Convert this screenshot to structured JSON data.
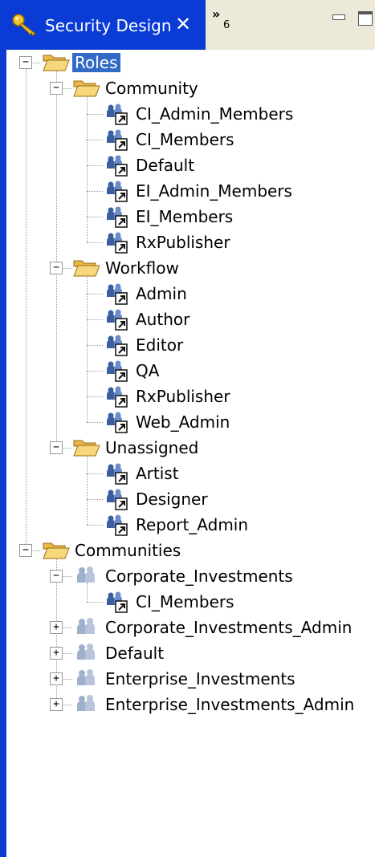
{
  "tab": {
    "title": "Security Design",
    "close_label": "✕",
    "overflow_label": "»",
    "overflow_count": "6"
  },
  "colors": {
    "tab_active": "#0a3bd4",
    "selection": "#316ac5",
    "tab_strip": "#ece9d8"
  },
  "tree": [
    {
      "label": "Roles",
      "icon": "folder-open-icon",
      "depth": 0,
      "toggle": "collapse",
      "selected": true
    },
    {
      "label": "Community",
      "icon": "folder-open-icon",
      "depth": 1,
      "toggle": "collapse"
    },
    {
      "label": "CI_Admin_Members",
      "icon": "role-link-icon",
      "depth": 2
    },
    {
      "label": "CI_Members",
      "icon": "role-link-icon",
      "depth": 2
    },
    {
      "label": "Default",
      "icon": "role-link-icon",
      "depth": 2
    },
    {
      "label": "EI_Admin_Members",
      "icon": "role-link-icon",
      "depth": 2
    },
    {
      "label": "EI_Members",
      "icon": "role-link-icon",
      "depth": 2
    },
    {
      "label": "RxPublisher",
      "icon": "role-link-icon",
      "depth": 2
    },
    {
      "label": "Workflow",
      "icon": "folder-open-icon",
      "depth": 1,
      "toggle": "collapse"
    },
    {
      "label": "Admin",
      "icon": "role-link-icon",
      "depth": 2
    },
    {
      "label": "Author",
      "icon": "role-link-icon",
      "depth": 2
    },
    {
      "label": "Editor",
      "icon": "role-link-icon",
      "depth": 2
    },
    {
      "label": "QA",
      "icon": "role-link-icon",
      "depth": 2
    },
    {
      "label": "RxPublisher",
      "icon": "role-link-icon",
      "depth": 2
    },
    {
      "label": "Web_Admin",
      "icon": "role-link-icon",
      "depth": 2
    },
    {
      "label": "Unassigned",
      "icon": "folder-open-icon",
      "depth": 1,
      "toggle": "collapse"
    },
    {
      "label": "Artist",
      "icon": "role-link-icon",
      "depth": 2
    },
    {
      "label": "Designer",
      "icon": "role-link-icon",
      "depth": 2
    },
    {
      "label": "Report_Admin",
      "icon": "role-link-icon",
      "depth": 2
    },
    {
      "label": "Communities",
      "icon": "folder-open-icon",
      "depth": 0,
      "toggle": "collapse"
    },
    {
      "label": "Corporate_Investments",
      "icon": "community-icon",
      "depth": 1,
      "toggle": "collapse"
    },
    {
      "label": "CI_Members",
      "icon": "role-link-icon",
      "depth": 2
    },
    {
      "label": "Corporate_Investments_Admin",
      "icon": "community-icon",
      "depth": 1,
      "toggle": "expand"
    },
    {
      "label": "Default",
      "icon": "community-icon",
      "depth": 1,
      "toggle": "expand"
    },
    {
      "label": "Enterprise_Investments",
      "icon": "community-icon",
      "depth": 1,
      "toggle": "expand"
    },
    {
      "label": "Enterprise_Investments_Admin",
      "icon": "community-icon",
      "depth": 1,
      "toggle": "expand"
    }
  ]
}
